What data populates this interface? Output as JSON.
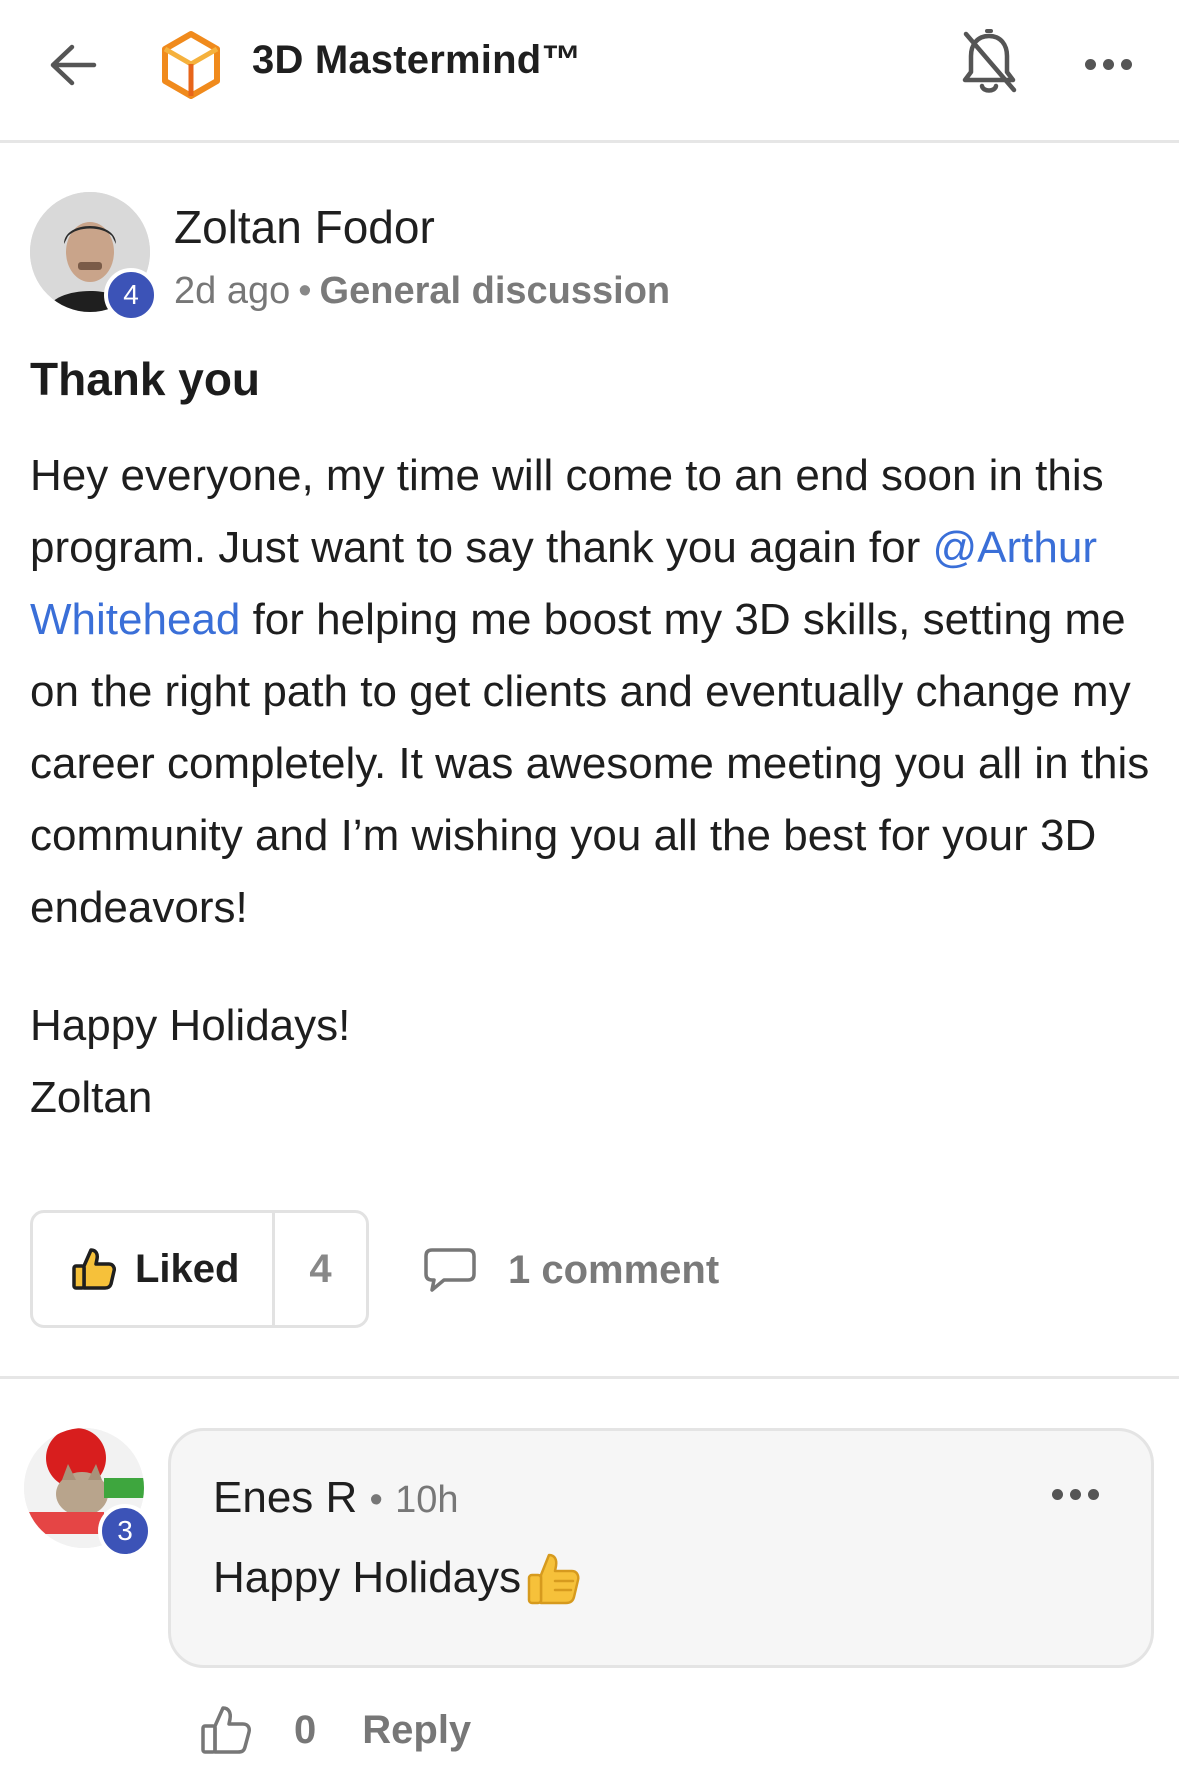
{
  "header": {
    "back_icon": "arrow-left-icon",
    "logo_icon": "hexagon-logo-icon",
    "title": "3D Mastermind™",
    "bell_icon": "bell-off-icon",
    "more_icon": "more-horizontal-icon"
  },
  "post": {
    "author": "Zoltan Fodor",
    "author_level": "4",
    "time": "2d ago",
    "separator": "•",
    "category": "General discussion",
    "title": "Thank you",
    "body_part1": "Hey everyone, my time will come to an end soon in this program. Just want to say thank you again for ",
    "mention": "@Arthur Whitehead",
    "body_part2": " for helping me boost my 3D skills, setting me on the right path to get clients and eventually change my career completely. It was awesome meeting you all in this community and I’m wishing you all the best for your 3D endeavors!",
    "closing_line1": "Happy Holidays!",
    "closing_line2": "Zoltan",
    "like_label": "Liked",
    "like_count": "4",
    "comment_label": "1 comment"
  },
  "comment": {
    "author": "Enes R",
    "author_level": "3",
    "separator": "•",
    "time": "10h",
    "text": "Happy Holidays",
    "emoji_icon": "thumbs-up-emoji-icon",
    "like_count": "0",
    "reply_label": "Reply"
  },
  "colors": {
    "accent_blue": "#3c53b7",
    "mention_blue": "#3a6fd8",
    "logo_orange": "#f08a1c",
    "emoji_yellow": "#f6c13a"
  }
}
